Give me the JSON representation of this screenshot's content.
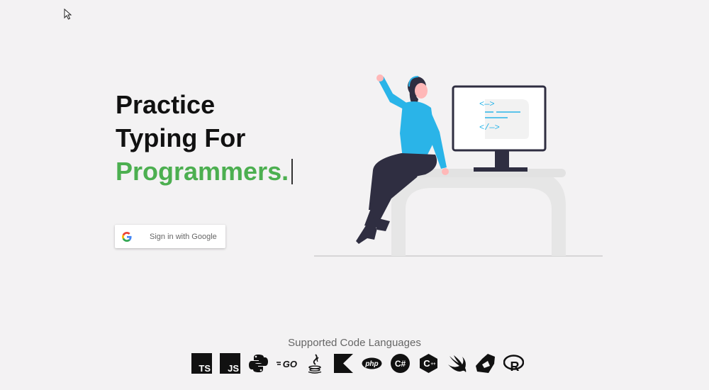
{
  "hero": {
    "line1": "Practice",
    "line2": "Typing For",
    "line3": "Programmers."
  },
  "auth": {
    "google_label": "Sign in with Google"
  },
  "monitor": {
    "code_open": "<—>",
    "code_close": "</—>"
  },
  "languages": {
    "title": "Supported Code Languages",
    "items": [
      {
        "name": "typescript-icon",
        "text": "TS"
      },
      {
        "name": "javascript-icon",
        "text": "JS"
      },
      {
        "name": "python-icon",
        "text": ""
      },
      {
        "name": "go-icon",
        "text": "GO"
      },
      {
        "name": "java-icon",
        "text": ""
      },
      {
        "name": "kotlin-icon",
        "text": ""
      },
      {
        "name": "php-icon",
        "text": "php"
      },
      {
        "name": "csharp-icon",
        "text": "C#"
      },
      {
        "name": "cpp-icon",
        "text": "C"
      },
      {
        "name": "swift-icon",
        "text": ""
      },
      {
        "name": "rust-icon",
        "text": ""
      },
      {
        "name": "r-icon",
        "text": "R"
      }
    ]
  },
  "colors": {
    "accent": "#4caf50",
    "figure_top": "#2ab4e8",
    "background": "#f3f2f3"
  }
}
